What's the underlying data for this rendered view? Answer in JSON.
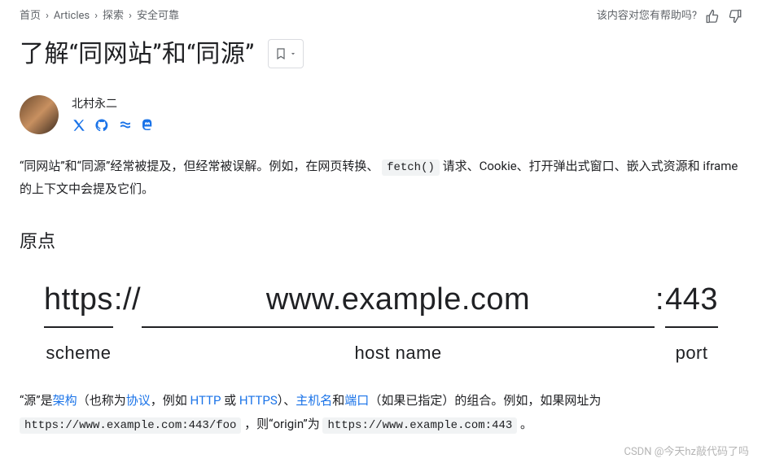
{
  "breadcrumb": {
    "items": [
      "首页",
      "Articles",
      "探索",
      "安全可靠"
    ]
  },
  "helpful": {
    "prompt": "该内容对您有帮助吗?"
  },
  "title": "了解“同网站”和“同源”",
  "author": {
    "name": "北村永二",
    "socials": [
      "x-icon",
      "github-icon",
      "glitch-icon",
      "mastodon-icon"
    ]
  },
  "intro": {
    "pre": "“同网站”和“同源”经常被提及，但经常被误解。例如，在网页转换、 ",
    "code": "fetch()",
    "post": " 请求、Cookie、打开弹出式窗口、嵌入式资源和 iframe 的上下文中会提及它们。"
  },
  "section_heading": "原点",
  "diagram": {
    "scheme": {
      "text": "https",
      "label": "scheme"
    },
    "sep1": "://",
    "host": {
      "text": "www.example.com",
      "label": "host name"
    },
    "sep2": ":",
    "port": {
      "text": "443",
      "label": "port"
    }
  },
  "explain": {
    "p1a": "“源”是",
    "link_arch": "架构",
    "p1b": "（也称为",
    "link_proto": "协议",
    "p1c": "，例如 ",
    "link_http": "HTTP",
    "p1d": " 或 ",
    "link_https": "HTTPS",
    "p1e": "）、",
    "link_host": "主机名",
    "p1f": "和",
    "link_port": "端口",
    "p1g": "（如果已指定）的组合。例如，如果网址为 ",
    "code_url": "https://www.example.com:443/foo",
    "p1h": " ，则“origin”为 ",
    "code_origin": "https://www.example.com:443",
    "p1i": " 。"
  },
  "watermark": "CSDN @今天hz敲代码了吗"
}
